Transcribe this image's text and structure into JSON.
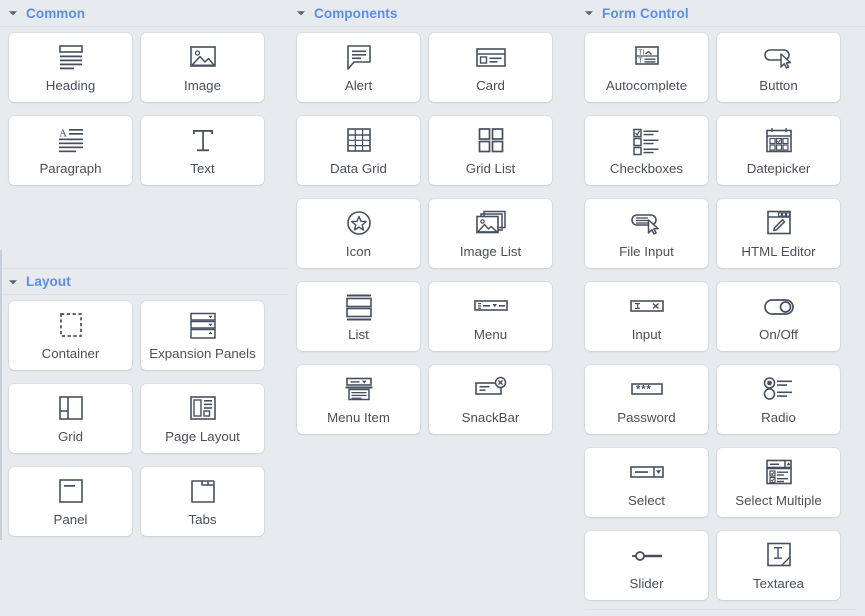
{
  "theme": {
    "background": "#e8ebee",
    "card_background": "#ffffff",
    "section_title_color": "#5b8def",
    "label_color": "#4a4f58",
    "icon_color": "#474f5e",
    "divider_color": "#dfe3e8"
  },
  "columns": [
    {
      "id": "column-left",
      "sections": [
        {
          "id": "common",
          "title": "Common",
          "expanded": true,
          "caret": "caret-down-icon",
          "items": [
            {
              "label": "Heading",
              "icon": "heading-icon"
            },
            {
              "label": "Image",
              "icon": "image-icon"
            },
            {
              "label": "Paragraph",
              "icon": "paragraph-icon"
            },
            {
              "label": "Text",
              "icon": "text-icon"
            }
          ]
        },
        {
          "id": "layout",
          "title": "Layout",
          "expanded": true,
          "caret": "caret-down-icon",
          "items": [
            {
              "label": "Container",
              "icon": "container-icon"
            },
            {
              "label": "Expansion Panels",
              "icon": "expansion-panels-icon"
            },
            {
              "label": "Grid",
              "icon": "grid-icon"
            },
            {
              "label": "Page Layout",
              "icon": "page-layout-icon"
            },
            {
              "label": "Panel",
              "icon": "panel-icon"
            },
            {
              "label": "Tabs",
              "icon": "tabs-icon"
            }
          ]
        }
      ]
    },
    {
      "id": "column-middle",
      "sections": [
        {
          "id": "components",
          "title": "Components",
          "expanded": true,
          "caret": "caret-down-icon",
          "items": [
            {
              "label": "Alert",
              "icon": "alert-icon"
            },
            {
              "label": "Card",
              "icon": "card-icon"
            },
            {
              "label": "Data Grid",
              "icon": "data-grid-icon"
            },
            {
              "label": "Grid List",
              "icon": "grid-list-icon"
            },
            {
              "label": "Icon",
              "icon": "star-badge-icon"
            },
            {
              "label": "Image List",
              "icon": "image-list-icon"
            },
            {
              "label": "List",
              "icon": "list-icon"
            },
            {
              "label": "Menu",
              "icon": "menu-icon"
            },
            {
              "label": "Menu Item",
              "icon": "menu-item-icon"
            },
            {
              "label": "SnackBar",
              "icon": "snackbar-icon"
            }
          ]
        }
      ]
    },
    {
      "id": "column-right",
      "sections": [
        {
          "id": "form-control",
          "title": "Form Control",
          "expanded": true,
          "caret": "caret-down-icon",
          "items": [
            {
              "label": "Autocomplete",
              "icon": "autocomplete-icon"
            },
            {
              "label": "Button",
              "icon": "button-icon"
            },
            {
              "label": "Checkboxes",
              "icon": "checkboxes-icon"
            },
            {
              "label": "Datepicker",
              "icon": "datepicker-icon"
            },
            {
              "label": "File Input",
              "icon": "file-input-icon"
            },
            {
              "label": "HTML Editor",
              "icon": "html-editor-icon"
            },
            {
              "label": "Input",
              "icon": "input-icon"
            },
            {
              "label": "On/Off",
              "icon": "toggle-icon"
            },
            {
              "label": "Password",
              "icon": "password-icon"
            },
            {
              "label": "Radio",
              "icon": "radio-icon"
            },
            {
              "label": "Select",
              "icon": "select-icon"
            },
            {
              "label": "Select Multiple",
              "icon": "select-multiple-icon"
            },
            {
              "label": "Slider",
              "icon": "slider-icon"
            },
            {
              "label": "Textarea",
              "icon": "textarea-icon"
            }
          ]
        }
      ]
    }
  ]
}
